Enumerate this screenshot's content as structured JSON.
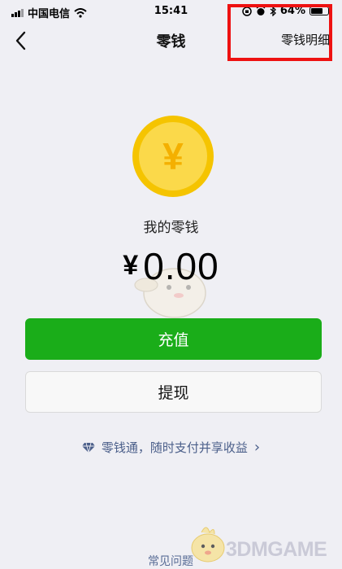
{
  "status_bar": {
    "carrier": "中国电信",
    "time": "15:41",
    "battery_text": "64%",
    "battery_level": 0.64
  },
  "nav": {
    "title": "零钱",
    "detail_link": "零钱明细"
  },
  "wallet": {
    "coin_symbol": "¥",
    "label": "我的零钱",
    "currency": "¥",
    "amount": "0.00"
  },
  "actions": {
    "recharge": "充值",
    "withdraw": "提现"
  },
  "promo": {
    "text": "零钱通，随时支付并享收益",
    "chevron": "›"
  },
  "footer": {
    "faq": "常见问题"
  },
  "watermark": {
    "text": "3DMGAME"
  },
  "colors": {
    "primary_green": "#1aad19",
    "coin_yellow": "#f5c400",
    "highlight_red": "#ee1111",
    "link_blue": "#576b95"
  },
  "icons": [
    "signal-icon",
    "wifi-icon",
    "orientation-lock-icon",
    "alarm-icon",
    "bluetooth-icon",
    "battery-icon",
    "back-icon",
    "diamond-icon"
  ]
}
